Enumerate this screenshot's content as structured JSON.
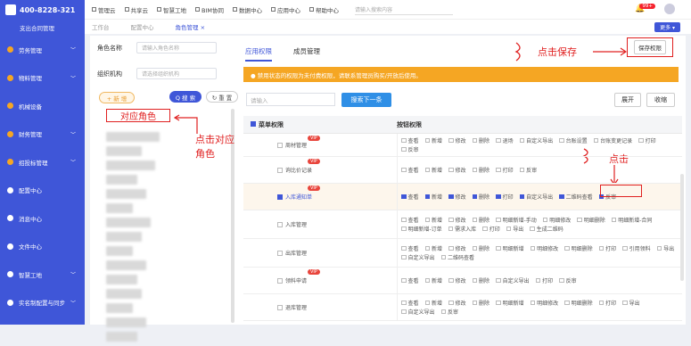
{
  "sidebar": {
    "phone": "400-8228-321",
    "company": "支出合同管理",
    "items": [
      {
        "label": "劳务管理",
        "color": "#f5a623",
        "chev": "﹀"
      },
      {
        "label": "物料管理",
        "color": "#f5a623",
        "chev": "﹀"
      },
      {
        "label": "机械设备",
        "color": "#f5a623",
        "chev": ""
      },
      {
        "label": "财务管理",
        "color": "#f5a623",
        "chev": "﹀"
      },
      {
        "label": "招投标管理",
        "color": "#f5a623",
        "chev": "﹀"
      },
      {
        "label": "配置中心",
        "color": "#ffffff",
        "chev": ""
      },
      {
        "label": "消息中心",
        "color": "#ffffff",
        "chev": ""
      },
      {
        "label": "文件中心",
        "color": "#ffffff",
        "chev": ""
      },
      {
        "label": "智慧工地",
        "color": "#ffffff",
        "chev": "﹀"
      },
      {
        "label": "实名制配置与同步",
        "color": "#ffffff",
        "chev": "﹀"
      }
    ]
  },
  "topbar": {
    "items": [
      "管理云",
      "共享云",
      "智慧工地",
      "BIM协同",
      "数据中心",
      "应用中心",
      "帮助中心"
    ],
    "search_placeholder": "请输入搜索内容",
    "badge": "99+"
  },
  "tabs": [
    "工作台",
    "配置中心",
    "角色管理 ×"
  ],
  "more": "更多 ▾",
  "left": {
    "role_name_label": "角色名称",
    "role_name_placeholder": "请输入角色名称",
    "org_label": "组织机构",
    "org_placeholder": "请选择组织机构",
    "new_btn": "+ 新 增",
    "search_btn": "Q 搜 索",
    "reset_btn": "↻ 重 置",
    "role_highlight": "对应角色",
    "ann_role": "点击对应角色"
  },
  "right": {
    "tab_app": "应用权限",
    "tab_member": "成员管理",
    "save": "保存权限",
    "ann_save": "点击保存",
    "ann_click": "点击",
    "warning": "● 禁用状态的权限为未付费权限，请联系管理员购买/开放后使用。",
    "input_placeholder": "请输入",
    "search_next": "搜索下一条",
    "expand": "展开",
    "collapse": "收缩",
    "col_menu": "菜单权限",
    "col_btn": "按钮权限"
  },
  "rows": [
    {
      "menu": "周材管理",
      "vip": "VIP",
      "sel": false,
      "h": 26,
      "btns": [
        "查看",
        "新增",
        "修改",
        "删除",
        "退场",
        "自定义导出",
        "台账设置",
        "台账变更记录",
        "打印",
        "反审"
      ]
    },
    {
      "menu": "询比价记录",
      "vip": "VIP",
      "sel": false,
      "h": 30,
      "btns": [
        "查看",
        "新增",
        "修改",
        "删除",
        "打印",
        "反审"
      ]
    },
    {
      "menu": "入库通知单",
      "vip": "VIP",
      "sel": true,
      "h": 30,
      "btns": [
        "查看",
        "新增",
        "修改",
        "删除",
        "打印",
        "自定义导出",
        "二维码查看",
        "反审"
      ]
    },
    {
      "menu": "入库管理",
      "vip": "",
      "sel": false,
      "h": 32,
      "btns": [
        "查看",
        "新增",
        "修改",
        "删除",
        "明细新增-手动",
        "明细修改",
        "明细删除",
        "明细新增-合同",
        "明细新增-订单",
        "需求入库",
        "打印",
        "导出",
        "生成二维码"
      ]
    },
    {
      "menu": "出库管理",
      "vip": "",
      "sel": false,
      "h": 32,
      "btns": [
        "查看",
        "新增",
        "修改",
        "删除",
        "明细新增",
        "明细修改",
        "明细删除",
        "打印",
        "引用领料",
        "导出",
        "自定义导出",
        "二维码查看"
      ]
    },
    {
      "menu": "领料申请",
      "vip": "VIP",
      "sel": false,
      "h": 30,
      "btns": [
        "查看",
        "新增",
        "修改",
        "删除",
        "自定义导出",
        "打印",
        "反审"
      ]
    },
    {
      "menu": "退库管理",
      "vip": "",
      "sel": false,
      "h": 30,
      "btns": [
        "查看",
        "新增",
        "修改",
        "删除",
        "明细新增",
        "明细修改",
        "明细删除",
        "打印",
        "导出",
        "自定义导出",
        "反审"
      ]
    }
  ]
}
